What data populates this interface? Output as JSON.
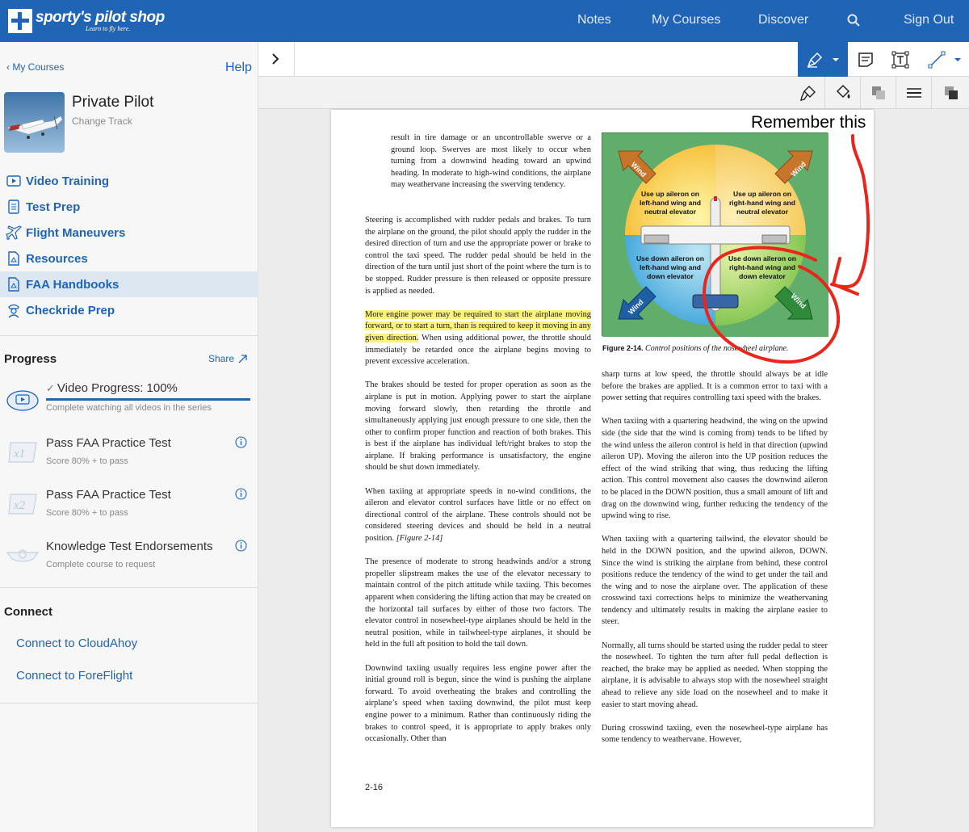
{
  "brand": {
    "name": "sporty's pilot shop",
    "tagline": "Learn to fly here."
  },
  "nav": {
    "notes": "Notes",
    "my_courses": "My Courses",
    "discover": "Discover",
    "sign_out": "Sign Out"
  },
  "sidebar": {
    "back": "My Courses",
    "help": "Help",
    "course_title": "Private Pilot",
    "change_track": "Change Track",
    "menu": [
      {
        "label": "Video Training",
        "icon": "video-icon"
      },
      {
        "label": "Test Prep",
        "icon": "checklist-icon"
      },
      {
        "label": "Flight Maneuvers",
        "icon": "airplane-icon"
      },
      {
        "label": "Resources",
        "icon": "document-icon"
      },
      {
        "label": "FAA Handbooks",
        "icon": "handbook-icon"
      },
      {
        "label": "Checkride Prep",
        "icon": "pilot-icon"
      }
    ],
    "active_index": 4,
    "progress_title": "Progress",
    "share": "Share",
    "progress": [
      {
        "title": "Video Progress: 100%",
        "sub": "Complete watching all videos in the series",
        "value": 1.0
      },
      {
        "title": "Pass FAA Practice Test",
        "sub": "Score 80% + to pass",
        "badge": "x1"
      },
      {
        "title": "Pass FAA Practice Test",
        "sub": "Score 80% + to pass",
        "badge": "x2"
      },
      {
        "title": "Knowledge Test Endorsements",
        "sub": "Complete course to request"
      }
    ],
    "connect_title": "Connect",
    "connect": [
      "Connect to CloudAhoy",
      "Connect to ForeFlight"
    ]
  },
  "figure": {
    "quad_tl": "Use up aileron on left-hand wing and neutral elevator",
    "quad_tr": "Use up aileron on right-hand wing and neutral elevator",
    "quad_bl": "Use down aileron on left-hand wing and down elevator",
    "quad_br": "Use down aileron on right-hand wing and down elevator",
    "wind": "Wind",
    "caption_label": "Figure 2-14.",
    "caption_text": "Control positions of the nosewheel airplane."
  },
  "annotation": {
    "text": "Remember this",
    "color": "#e8261c"
  },
  "doc": {
    "page_number": "2-16",
    "left": {
      "p1": "result in tire damage or an uncontrollable swerve or a ground loop. Swerves are most likely to occur when turning from a downwind heading toward an upwind heading. In moderate to high-wind conditions, the airplane may weathervane increasing the swerving tendency.",
      "p2": "Steering is accomplished with rudder pedals and brakes. To turn the airplane on the ground, the pilot should apply the rudder in the desired direction of turn and use the appropriate power or brake to control the taxi speed. The rudder pedal should be held in the direction of the turn until just short of the point where the turn is to be stopped. Rudder pressure is then released or opposite pressure is applied as needed.",
      "p3_hl": "More engine power may be required to start the airplane moving forward, or to start a turn, than is required to keep it moving in any given direction.",
      "p3_rest": " When using additional power, the throttle should immediately be retarded once the airplane begins moving to prevent excessive acceleration.",
      "p4": "The brakes should be tested for proper operation as soon as the airplane is put in motion. Applying power to start the airplane moving forward slowly, then retarding the throttle and simultaneously applying just enough pressure to one side, then the other to confirm proper function and reaction of both brakes. This is best if the airplane has individual left/right brakes to stop the airplane. If braking performance is unsatisfactory, the engine should be shut down immediately.",
      "p5": "When taxiing at appropriate speeds in no-wind conditions, the aileron and elevator control surfaces have little or no effect on directional control of the airplane. These controls should not be considered steering devices and should be held in a neutral position.",
      "p5_ref": "[Figure 2-14]",
      "p6": "The presence of moderate to strong headwinds and/or a strong propeller slipstream makes the use of the elevator necessary to maintain control of the pitch attitude while taxiing. This becomes apparent when considering the lifting action that may be created on the horizontal tail surfaces by either of those two factors. The elevator control in nosewheel-type airplanes should be held in the neutral position, while in tailwheel-type airplanes, it should be held in the full aft position to hold the tail down.",
      "p7": "Downwind taxiing usually requires less engine power after the initial ground roll is begun, since the wind is pushing the airplane forward. To avoid overheating the brakes and controlling the airplane’s speed when taxiing downwind, the pilot must keep engine power to a minimum. Rather than continuously riding the brakes to control speed, it is appropriate to apply brakes only occasionally. Other than"
    },
    "right": {
      "p1": "sharp turns at low speed, the throttle should always be at idle before the brakes are applied. It is a common error to taxi with a power setting that requires controlling taxi speed with the brakes.",
      "p2": "When taxiing with a quartering headwind, the wing on the upwind side (the side that the wind is coming from) tends to be lifted by the wind unless the aileron control is held in that direction (upwind aileron UP). Moving the aileron into the UP position reduces the effect of the wind striking that wing, thus reducing the lifting action. This control movement also causes the downwind aileron to be placed in the DOWN position, thus a small amount of lift and drag on the downwind wing, further reducing the tendency of the upwind wing to rise.",
      "p3": "When taxiing with a quartering tailwind, the elevator should be held in the DOWN position, and the upwind aileron, DOWN. Since the wind is striking the airplane from behind, these control positions reduce the tendency of the wind to get under the tail and the wing and to nose the airplane over. The application of these crosswind taxi corrections helps to minimize the weathervaning tendency and ultimately results in making the airplane easier to steer.",
      "p4": "Normally, all turns should be started using the rudder pedal to steer the nosewheel. To tighten the turn after full pedal deflection is reached, the brake may be applied as needed. When stopping the airplane, it is advisable to always stop with the nosewheel straight ahead to relieve any side load on the nosewheel and to make it easier to start moving ahead.",
      "p5": "During crosswind taxiing, even the nosewheel-type airplane has some tendency to weathervane. However,"
    }
  },
  "colors": {
    "brand_blue": "#1f64b5",
    "highlight": "#fbf27a",
    "active_row": "#dde7f2"
  }
}
